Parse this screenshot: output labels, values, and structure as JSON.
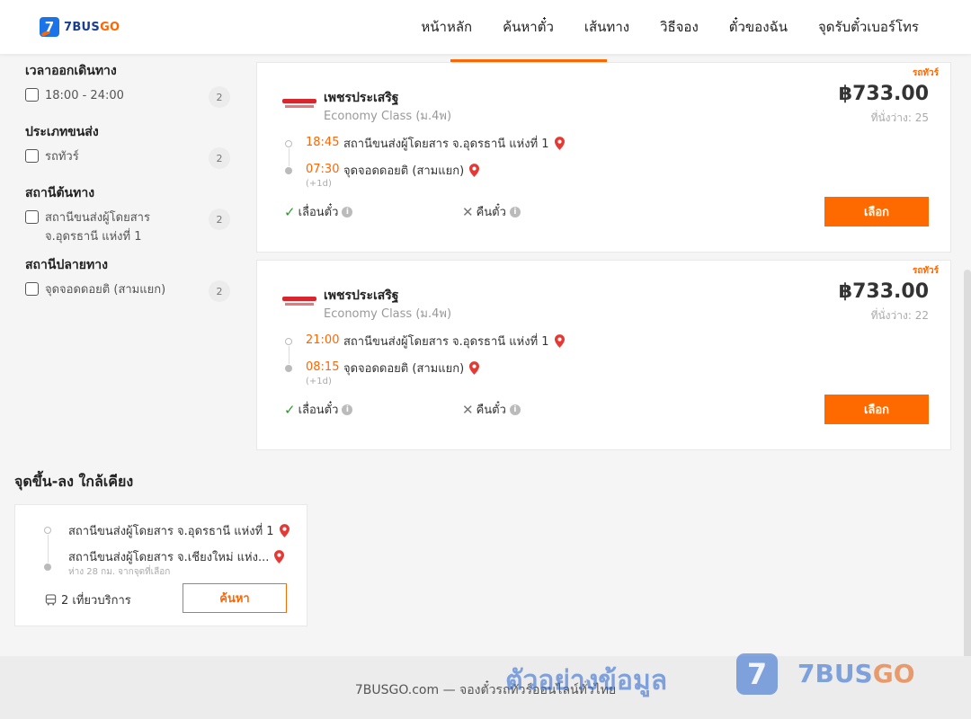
{
  "brand": {
    "name_prefix": "7BUS",
    "name_suffix": "GO",
    "logo_digit": "7"
  },
  "nav": {
    "items": [
      {
        "label": "หน้าหลัก"
      },
      {
        "label": "ค้นหาตั๋ว"
      },
      {
        "label": "เส้นทาง"
      },
      {
        "label": "วิธีจอง"
      },
      {
        "label": "ตั๋วของฉัน"
      },
      {
        "label": "จุดรับตั๋วเบอร์โทร"
      }
    ]
  },
  "filters": {
    "departure_time": {
      "title": "เวลาออกเดินทาง",
      "option": "18:00 - 24:00",
      "count": "2"
    },
    "transport_type": {
      "title": "ประเภทขนส่ง",
      "option": "รถทัวร์",
      "count": "2"
    },
    "origin": {
      "title": "สถานีต้นทาง",
      "option": "สถานีขนส่งผู้โดยสาร จ.อุดรธานี แห่งที่ 1",
      "count": "2"
    },
    "destination": {
      "title": "สถานีปลายทาง",
      "option": "จุดจอดดอยติ (สามแยก)",
      "count": "2"
    }
  },
  "trips": [
    {
      "tag": "รถทัวร์",
      "operator": "เพชรประเสริฐ",
      "class": "Economy Class (ม.4พ)",
      "price": "฿733.00",
      "seats": "ที่นั่งว่าง: 25",
      "depart_time": "18:45",
      "depart_station": "สถานีขนส่งผู้โดยสาร จ.อุดรธานี แห่งที่ 1",
      "arrive_time": "07:30",
      "arrive_station": "จุดจอดดอยติ (สามแยก)",
      "day_offset": "(+1d)",
      "reschedule": "เลื่อนตั๋ว",
      "refund": "คืนตั๋ว",
      "select": "เลือก"
    },
    {
      "tag": "รถทัวร์",
      "operator": "เพชรประเสริฐ",
      "class": "Economy Class (ม.4พ)",
      "price": "฿733.00",
      "seats": "ที่นั่งว่าง: 22",
      "depart_time": "21:00",
      "depart_station": "สถานีขนส่งผู้โดยสาร จ.อุดรธานี แห่งที่ 1",
      "arrive_time": "08:15",
      "arrive_station": "จุดจอดดอยติ (สามแยก)",
      "day_offset": "(+1d)",
      "reschedule": "เลื่อนตั๋ว",
      "refund": "คืนตั๋ว",
      "select": "เลือก"
    }
  ],
  "nearby": {
    "title": "จุดขึ้น-ลง ใกล้เคียง",
    "from_station": "สถานีขนส่งผู้โดยสาร จ.อุดรธานี แห่งที่ 1",
    "to_station": "สถานีขนส่งผู้โดยสาร จ.เชียงใหม่ แห่ง...",
    "distance": "ห่าง 28 กม. จากจุดที่เลือก",
    "trips": "2 เที่ยวบริการ",
    "search": "ค้นหา"
  },
  "footer": {
    "text": "7BUSGO.com — จองตั๋วรถทัวร์ออนไลน์ทั่วไทย"
  },
  "watermark": {
    "text": "ตัวอย่างข้อมูล",
    "digit": "7",
    "brand_prefix": "7BUS",
    "brand_suffix": "GO"
  },
  "colors": {
    "accent": "#ff6a00",
    "brand_blue": "#1a73e8",
    "ok_green": "#2a9d2a"
  }
}
